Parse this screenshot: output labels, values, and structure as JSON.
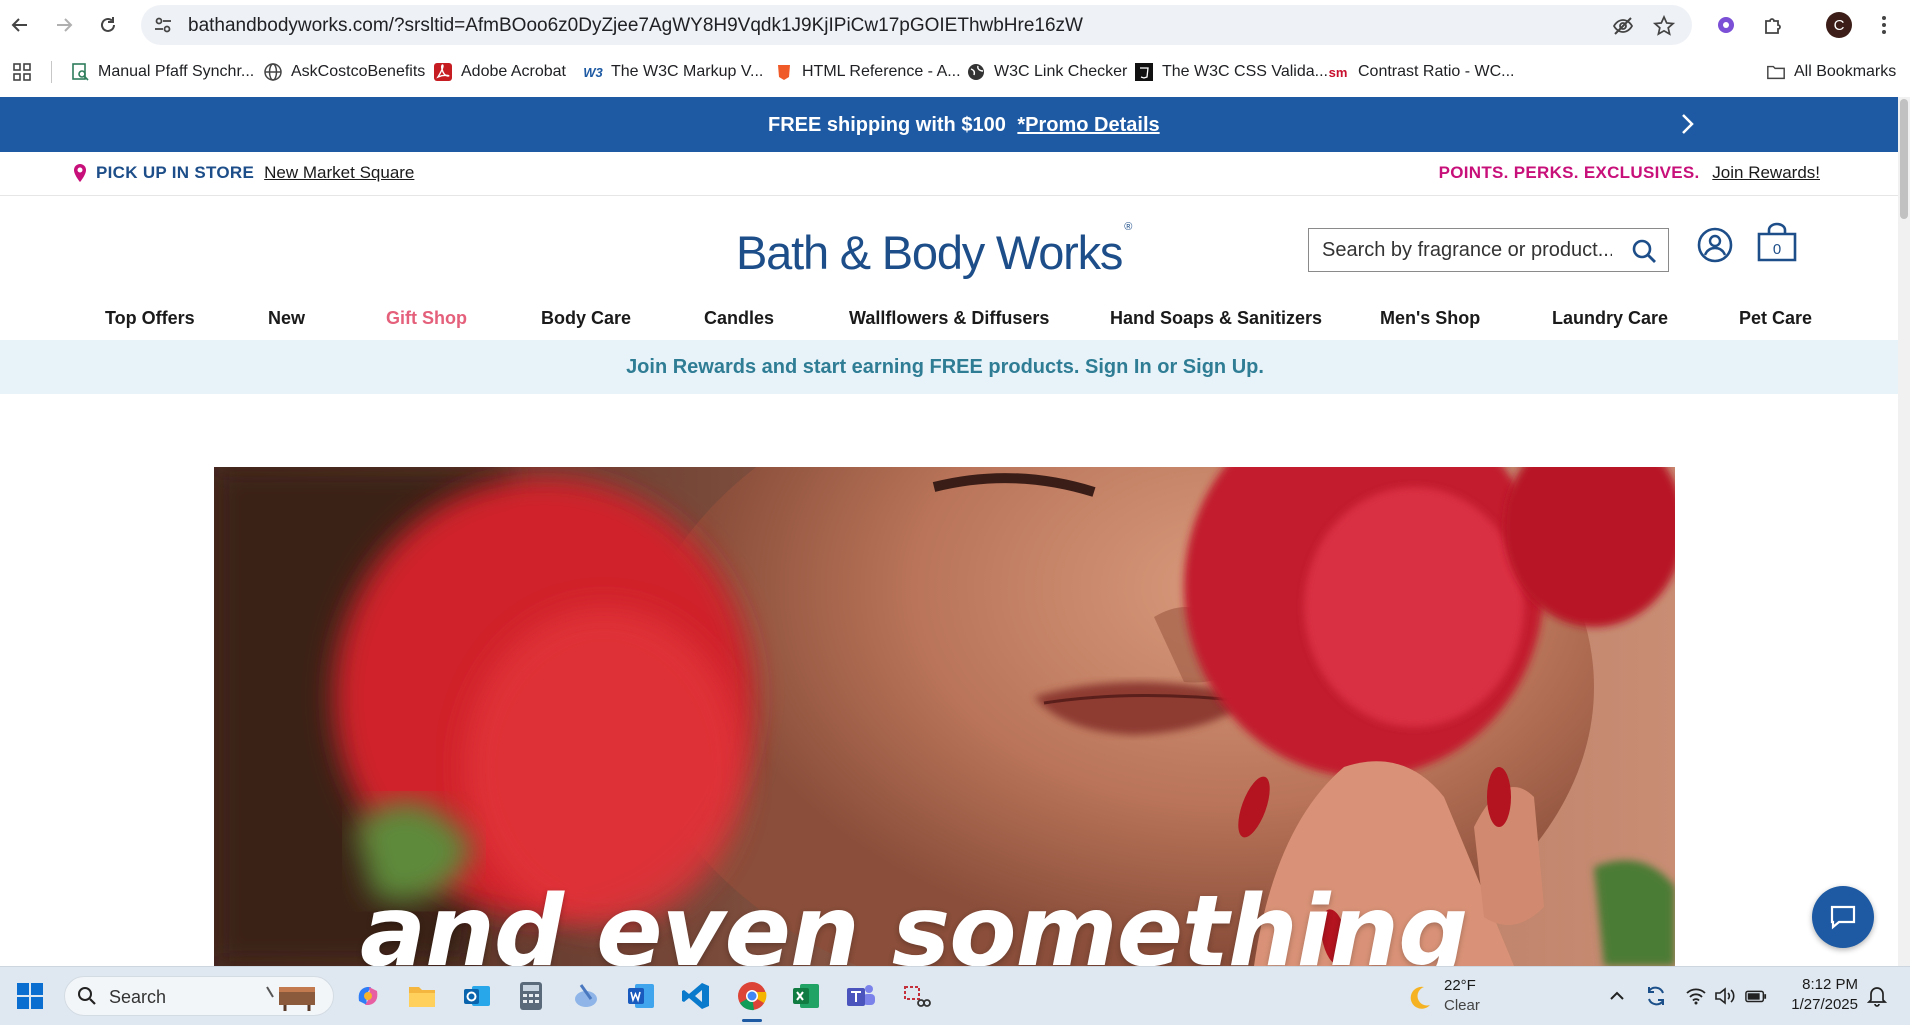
{
  "browser": {
    "url": "bathandbodyworks.com/?srsltid=AfmBOoo6z0DyZjee7AgWY8H9Vqdk1J9KjIPiCw17pGOIEThwbHre16zW",
    "profile_initial": "C",
    "icons": {
      "back": "back-arrow-icon",
      "forward": "forward-arrow-icon",
      "reload": "reload-icon",
      "site_info": "tune-icon",
      "tracking": "eye-off-icon",
      "bookmark": "star-icon",
      "extension_one": "gear-flower-icon",
      "extensions": "puzzle-icon",
      "menu": "kebab-menu-icon"
    },
    "bookmarks": [
      {
        "label": "Manual Pfaff Synchr...",
        "icon": "document-search-icon"
      },
      {
        "label": "AskCostcoBenefits",
        "icon": "globe-icon"
      },
      {
        "label": "Adobe Acrobat",
        "icon": "acrobat-icon"
      },
      {
        "label": "The W3C Markup V...",
        "icon": "w3c-icon"
      },
      {
        "label": "HTML Reference - A...",
        "icon": "shield-icon"
      },
      {
        "label": "W3C Link Checker",
        "icon": "globe-dark-icon"
      },
      {
        "label": "The W3C CSS Valida...",
        "icon": "css-icon"
      },
      {
        "label": "Contrast Ratio - WC...",
        "icon": "sm-icon"
      }
    ],
    "bookmark_sm": "sm",
    "all_bookmarks": "All Bookmarks"
  },
  "promo": {
    "text": "FREE shipping with $100",
    "link": "*Promo Details",
    "bg_color": "#1d5aa3"
  },
  "utility": {
    "pickup_label": "PICK UP IN STORE",
    "store_name": "New Market Square",
    "perks": "POINTS. PERKS. EXCLUSIVES.",
    "join": "Join Rewards!"
  },
  "header": {
    "logo_text": "Bath & Body Works",
    "logo_mark": "®",
    "search_placeholder": "Search by fragrance or product...",
    "bag_count": "0"
  },
  "nav": [
    "Top Offers",
    "New",
    "Gift Shop",
    "Body Care",
    "Candles",
    "Wallflowers & Diffusers",
    "Hand Soaps & Sanitizers",
    "Men's Shop",
    "Laundry Care",
    "Pet Care"
  ],
  "rewards_banner": "Join Rewards and start earning FREE products. Sign In or Sign Up.",
  "hero": {
    "caption": "and even something"
  },
  "taskbar": {
    "search_label": "Search",
    "weather_temp": "22°F",
    "weather_cond": "Clear",
    "time": "8:12 PM",
    "date": "1/27/2025"
  }
}
